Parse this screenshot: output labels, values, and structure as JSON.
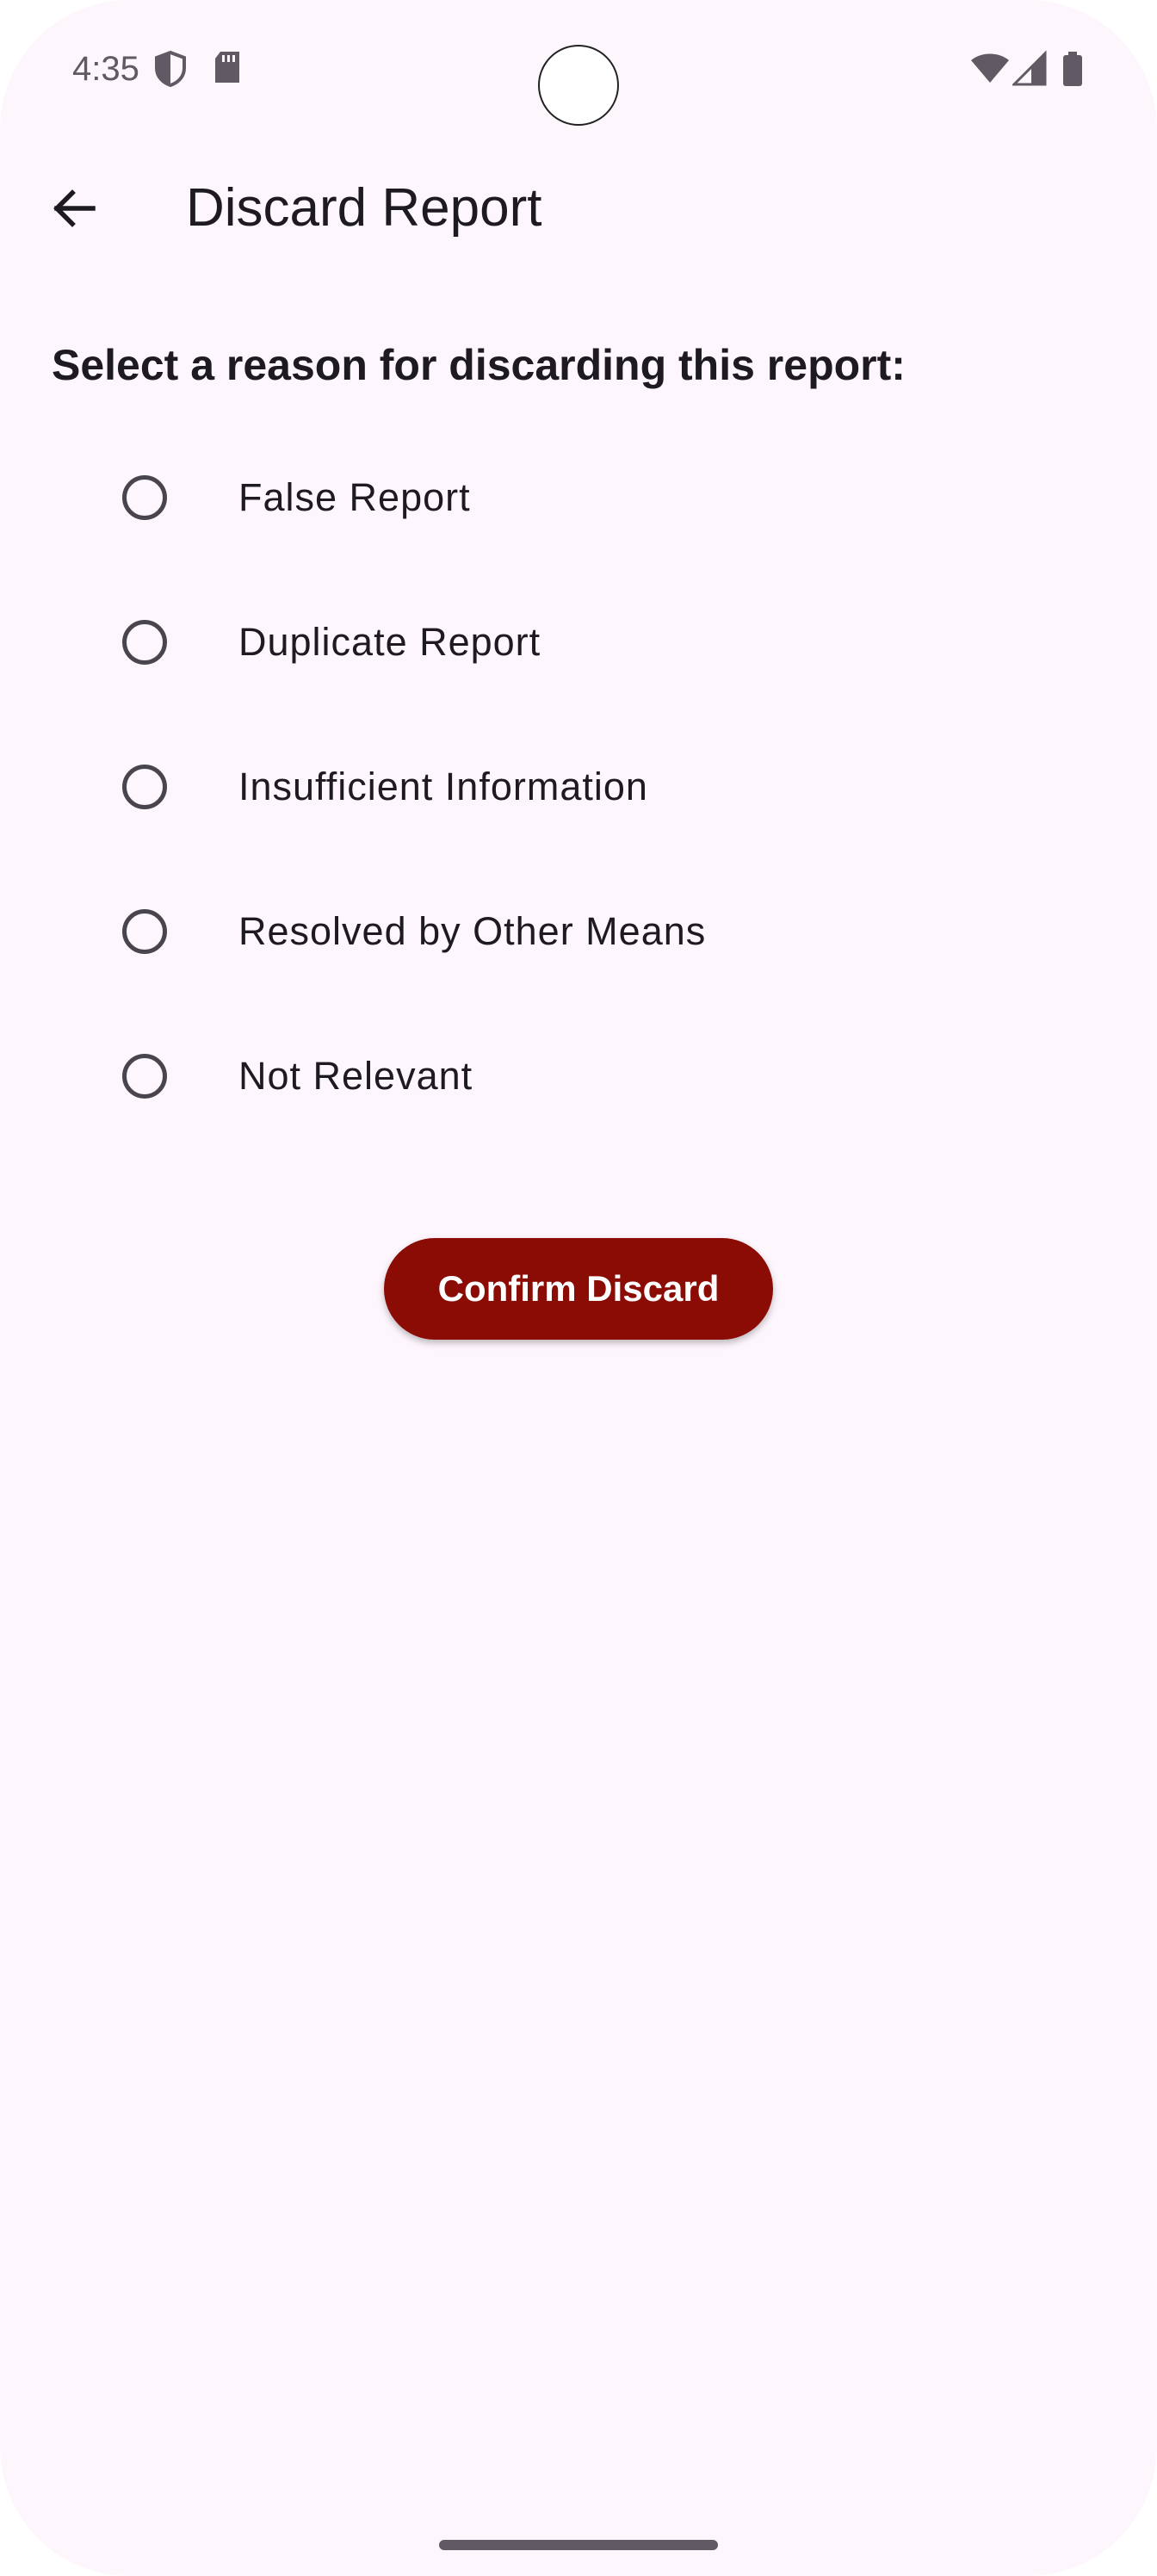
{
  "status_bar": {
    "time": "4:35",
    "icons_left": [
      "shield-icon",
      "sd-card-icon"
    ],
    "icons_right": [
      "wifi-icon",
      "signal-icon",
      "battery-icon"
    ]
  },
  "app_bar": {
    "back_icon": "arrow-back-icon",
    "title": "Discard Report"
  },
  "prompt": "Select a reason for discarding this report:",
  "options": [
    {
      "label": "False Report",
      "selected": false
    },
    {
      "label": "Duplicate Report",
      "selected": false
    },
    {
      "label": "Insufficient Information",
      "selected": false
    },
    {
      "label": "Resolved by Other Means",
      "selected": false
    },
    {
      "label": "Not Relevant",
      "selected": false
    }
  ],
  "confirm_button": {
    "label": "Confirm Discard"
  },
  "colors": {
    "background": "#FDF6FC",
    "button": "#8B0B05",
    "text": "#1D1B20",
    "radio": "#49454F"
  }
}
